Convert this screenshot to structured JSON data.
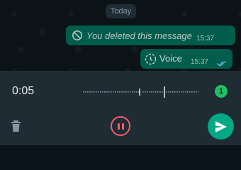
{
  "chat": {
    "date_chip": "Today",
    "messages": [
      {
        "type": "deleted",
        "text": "You deleted this message",
        "time": "15:37",
        "icon": "deleted-icon"
      },
      {
        "type": "voice",
        "text": "Voice",
        "time": "15:37",
        "icon": "voice-pending-icon",
        "status": "read-ticks"
      }
    ]
  },
  "recorder": {
    "elapsed": "0:05",
    "badge_count": "1",
    "icons": {
      "discard": "trash-icon",
      "pause": "pause-icon",
      "send": "send-icon"
    },
    "colors": {
      "accent": "#00a884",
      "pause": "#f15c6d",
      "badge": "#21c063"
    }
  }
}
